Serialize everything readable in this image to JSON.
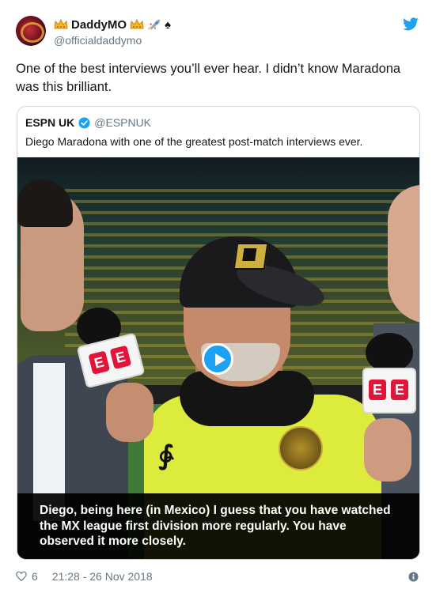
{
  "author": {
    "display_name": "DaddyMO",
    "handle": "@officialdaddymo",
    "name_emojis": [
      "crown-emoji",
      "crown-emoji",
      "rocket-emoji",
      "spade-emoji"
    ]
  },
  "tweet": {
    "text": "One of the best interviews you’ll ever hear. I didn’t know Maradona was this brilliant."
  },
  "quoted": {
    "name": "ESPN UK",
    "handle": "@ESPNUK",
    "text": "Diego Maradona with one of the greatest post-match interviews ever.",
    "video": {
      "subtitle": "Diego, being here (in Mexico) I guess that you have watched the MX league first division more regularly. You have observed it more closely.",
      "mic_letters": "E"
    }
  },
  "footer": {
    "likes": "6",
    "timestamp": "21:28 - 26 Nov 2018"
  },
  "colors": {
    "twitter_blue": "#1da1f2",
    "secondary_text": "#657786",
    "border": "#ccd6dd",
    "espn_red": "#e3143a"
  },
  "icons": [
    "twitter-bird-icon",
    "verified-badge-icon",
    "play-icon",
    "heart-icon",
    "info-icon"
  ]
}
